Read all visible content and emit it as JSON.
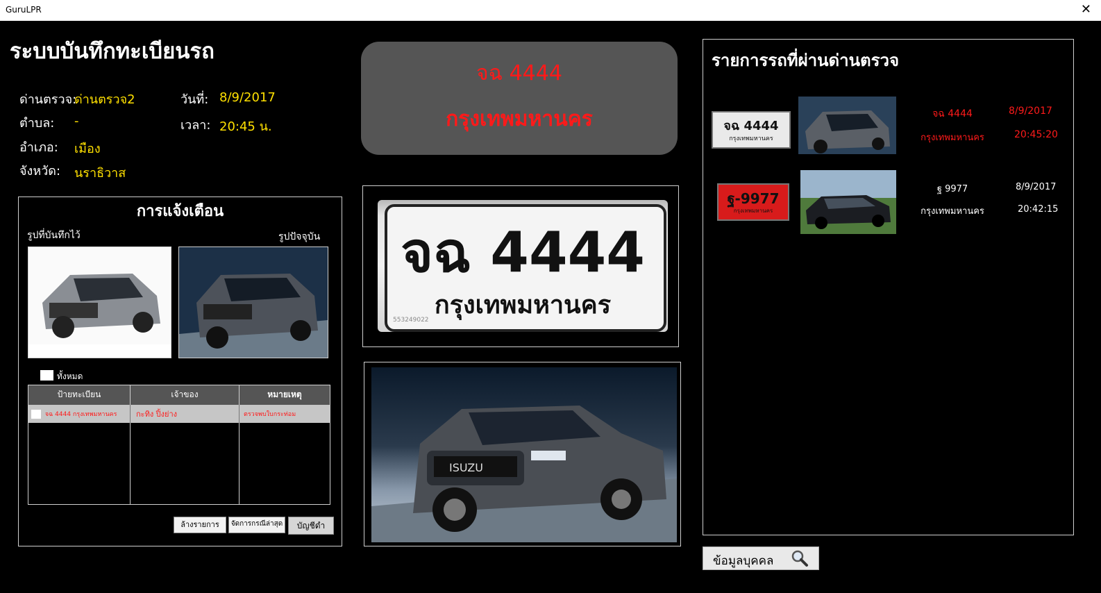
{
  "window": {
    "title": "GuruLPR",
    "close_glyph": "✕"
  },
  "header": {
    "title": "ระบบบันทึกทะเบียนรถ"
  },
  "checkpoint": {
    "checkpoint_label": "ด่านตรวจ:",
    "checkpoint_value": "ด่านตรวจ2",
    "subdistrict_label": "ตำบล:",
    "subdistrict_value": "-",
    "district_label": "อำเภอ:",
    "district_value": "เมือง",
    "province_label": "จังหวัด:",
    "province_value": "นราธิวาส",
    "date_label": "วันที่:",
    "date_value": "8/9/2017",
    "time_label": "เวลา:",
    "time_value": "20:45 น."
  },
  "current": {
    "plate": "จฉ 4444",
    "province": "กรุงเทพมหานคร"
  },
  "current_plate_image": {
    "plate": "จฉ 4444",
    "province": "กรุงเทพมหานคร",
    "serial": "553249022"
  },
  "alert": {
    "title": "การแจ้งเตือน",
    "saved_label": "รูปที่บันทึกไว้",
    "current_label": "รูปปัจจุบัน",
    "select_all_label": "ทั้งหมด",
    "columns": [
      "ป้ายทะเบียน",
      "เจ้าของ",
      "หมายเหตุ"
    ],
    "rows": [
      {
        "plate": "จฉ 4444 กรุงเทพมหานคร",
        "owner": "กะทิง ปิ้งย่าง",
        "note": "ตรวจพบใบกระท่อม"
      }
    ],
    "buttons": {
      "clear": "ล้างรายการ",
      "manage": "จัดการกรณีล่าสุด",
      "blacklist": "บัญชีดำ"
    }
  },
  "passed": {
    "title": "รายการรถที่ผ่านด่านตรวจ",
    "items": [
      {
        "plate": "จฉ 4444",
        "province": "กรุงเทพมหานคร",
        "date": "8/9/2017",
        "time": "20:45:20",
        "plate_img_text": "จฉ 4444",
        "plate_img_province": "กรุงเทพมหานคร",
        "color": "#ff1a1a"
      },
      {
        "plate": "ฐ 9977",
        "province": "กรุงเทพมหานคร",
        "date": "8/9/2017",
        "time": "20:42:15",
        "plate_img_text": "ฐ-9977",
        "plate_img_province": "กรุงเทพมหานคร",
        "color": "#ffffff"
      }
    ]
  },
  "person_button": {
    "label": "ข้อมูลบุคคล"
  },
  "icons": {
    "search": "search-icon",
    "car_photo": "pickup-truck-photo",
    "sedan_photo": "sedan-photo"
  },
  "colors": {
    "accent_yellow": "#ffe000",
    "alert_red": "#ff1a1a",
    "panel_gray": "#555555"
  }
}
